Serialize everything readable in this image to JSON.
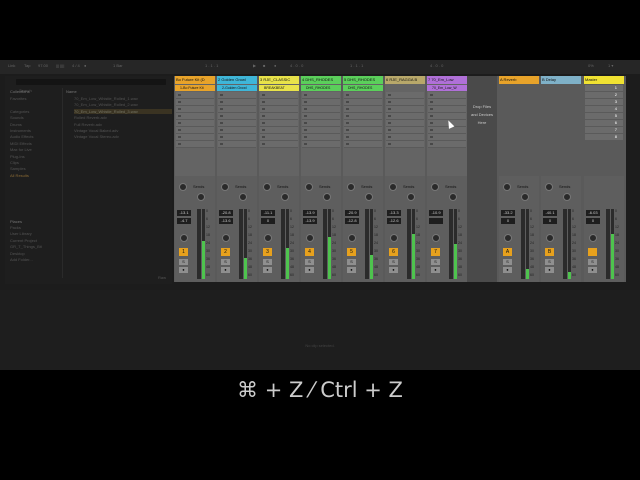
{
  "topbar": {
    "items": [
      "Link",
      "Tap",
      "97.00",
      "|||  ||||",
      "4 / 4",
      "●",
      "1 Bar",
      "1 . 1 . 1",
      "▶",
      "■",
      "●",
      "4 . 0 . 0",
      "1 . 1 . 1",
      "4 . 0 . 0",
      "0%",
      "1 ▾"
    ]
  },
  "browser": {
    "search_placeholder": "Search",
    "categories_header": "Collections",
    "categories": [
      "Favorites",
      "",
      "Categories",
      "Sounds",
      "Drums",
      "Instruments",
      "Audio Effects",
      "MIDI Effects",
      "Max for Live",
      "Plug-Ins",
      "Clips",
      "Samples",
      "All Results"
    ],
    "places_header": "Places",
    "places": [
      "Packs",
      "User Library",
      "Current Project",
      "GR_T_Things_Bit",
      "Desktop",
      "Add Folder..."
    ],
    "name_header": "Name",
    "files": [
      "70_Em_Low_Whistle_Rolled_1.wav",
      "70_Em_Low_Whistle_Rolled_2.wav",
      "70_Em_Low_Whistle_Rolled_3.wav",
      "Rolled Reverb.adv",
      "Full Reverb.adv",
      "Vintage Vocal Baked.adv",
      "Vintage Vocal Stereo.adv"
    ],
    "selected_file_index": 2,
    "footer": "Raw"
  },
  "tracks": [
    {
      "name": "Bo Future Kit (D",
      "clip": "1-Bo Future Kit",
      "color": "#e8a32a",
      "track_num": "1",
      "vol": "-13.1",
      "pan": "-4.7",
      "meter": 0.55,
      "label": "12",
      "label2": "38"
    },
    {
      "name": "2 Golden Growl",
      "clip": "2-Golden Growl",
      "color": "#3fb6d8",
      "track_num": "2",
      "vol": "-20.8",
      "pan": "-13.6",
      "meter": 0.3,
      "label": "4",
      "label2": "48"
    },
    {
      "name": "3 RJE_CLASSIC",
      "clip": "BREAKBEAT",
      "color": "#e8e24a",
      "track_num": "3",
      "vol": "-11.1",
      "pan": "0",
      "meter": 0.45,
      "label": "24",
      "label2": "8"
    },
    {
      "name": "4 DHS_RHODES",
      "clip": "DHS_RHODES",
      "color": "#5bcf5b",
      "track_num": "4",
      "vol": "-13.9",
      "pan": "-13.9",
      "meter": 0.6,
      "label": "",
      "label2": ""
    },
    {
      "name": "5 DHS_RHODES",
      "clip": "DHS_RHODES",
      "color": "#5bcf5b",
      "track_num": "5",
      "vol": "-20.9",
      "pan": "-12.8",
      "meter": 0.35,
      "label": "",
      "label2": ""
    },
    {
      "name": "6 RJE_RAGGA B",
      "clip": "",
      "color": "#b8a86a",
      "track_num": "6",
      "vol": "-13.3",
      "pan": "-12.6",
      "meter": 0.65,
      "label": "",
      "label2": ""
    },
    {
      "name": "7 70_Em_Low",
      "clip": "70_Em_Low_W",
      "color": "#b070d8",
      "track_num": "7",
      "vol": "-10.9",
      "pan": "",
      "meter": 0.5,
      "label": "3",
      "label2": "36"
    }
  ],
  "returns": [
    {
      "name": "A Reverb",
      "color": "#e8a32a",
      "track_num": "A",
      "vol": "-33.2",
      "pan": "0",
      "meter": 0.15
    },
    {
      "name": "B Delay",
      "color": "#7fb1c8",
      "track_num": "B",
      "vol": "-40.1",
      "pan": "0",
      "meter": 0.1
    }
  ],
  "master": {
    "name": "Master",
    "color": "#f0e232",
    "vol": "-6.03",
    "pan": "0",
    "meter": 0.65,
    "scenes": [
      "1",
      "2",
      "3",
      "4",
      "5",
      "6",
      "7",
      "8"
    ]
  },
  "drop_area": {
    "line1": "Drop Files",
    "line2": "and Devices",
    "line3": "Here"
  },
  "mixer_labels": {
    "sends": "Sends",
    "scale": [
      "0",
      "6",
      "12",
      "18",
      "24",
      "30",
      "36",
      "48",
      "60"
    ]
  },
  "status_bar": {
    "text": "No clip selected."
  },
  "shortcut": {
    "text": "⌘ + Z ⁄ Ctrl + Z"
  }
}
